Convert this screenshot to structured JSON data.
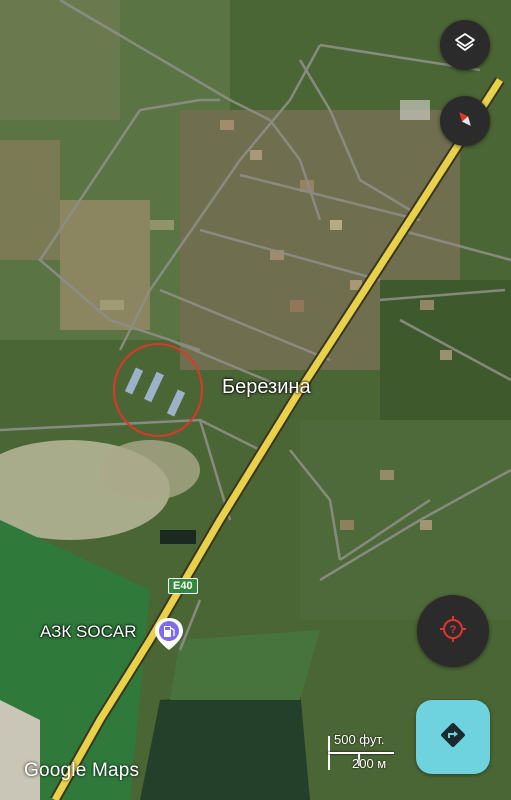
{
  "map": {
    "town_label": "Березина",
    "highway_shield": "E40",
    "poi_label": "АЗК SOCAR",
    "scale_top": "500 фут.",
    "scale_bottom": "200 м",
    "attribution": "Google Maps"
  },
  "controls": {
    "layers_icon": "layers-icon",
    "compass_icon": "compass-icon",
    "locate_icon": "location-unknown-icon",
    "directions_icon": "directions-icon"
  },
  "colors": {
    "highway": "#e8d24a",
    "circle": "#e0352b",
    "directions": "#6fd3df",
    "control_bg": "#2b2b2b",
    "locate_accent": "#e0352b"
  }
}
